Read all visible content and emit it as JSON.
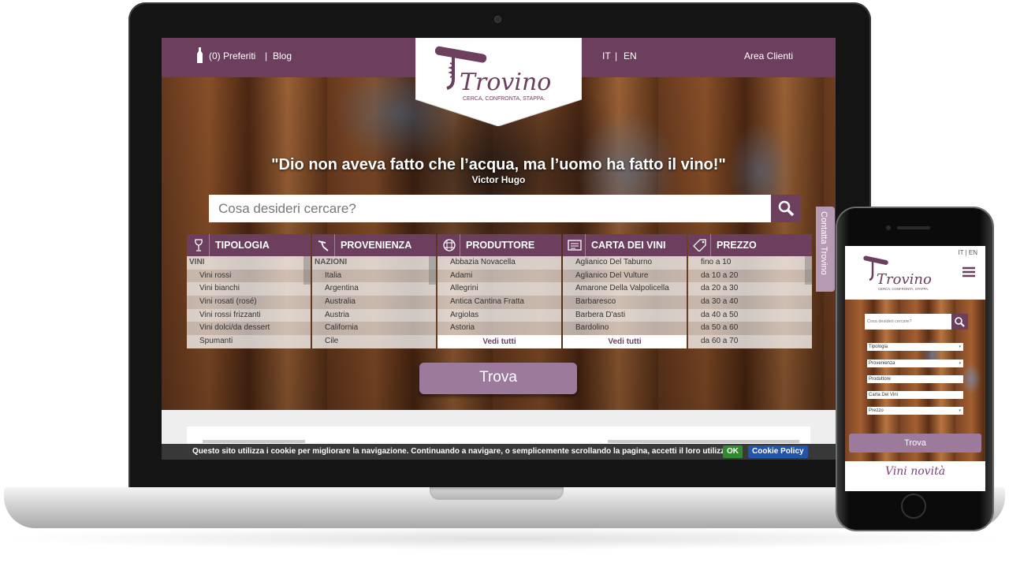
{
  "topbar": {
    "favorites": "(0) Preferiti",
    "separator": "|",
    "blog": "Blog",
    "lang_it": "IT",
    "lang_sep": "|",
    "lang_en": "EN",
    "client_area": "Area Clienti"
  },
  "logo": {
    "name": "Trovino",
    "tagline": "CERCA, CONFRONTA, STAPPA."
  },
  "hero": {
    "quote": "\"Dio non aveva fatto che l’acqua, ma l’uomo ha fatto il vino!\"",
    "author": "Victor Hugo",
    "search_placeholder": "Cosa desideri cercare?",
    "search_icon": "magnifier-icon",
    "submit_label": "Trova"
  },
  "filters": [
    {
      "title": "TIPOLOGIA",
      "icon": "wine-glass-icon",
      "group": "VINI",
      "items": [
        "Vini rossi",
        "Vini bianchi",
        "Vini rosati (rosé)",
        "Vini rossi frizzanti",
        "Vini dolci/da dessert",
        "Spumanti"
      ],
      "more": ""
    },
    {
      "title": "PROVENIENZA",
      "icon": "corkscrew-icon",
      "group": "NAZIONI",
      "items": [
        "Italia",
        "Argentina",
        "Australia",
        "Austria",
        "California",
        "Cile"
      ],
      "more": ""
    },
    {
      "title": "PRODUTTORE",
      "icon": "barrel-icon",
      "group": "",
      "items": [
        "Abbazia Novacella",
        "Adami",
        "Allegrini",
        "Antica Cantina Fratta",
        "Argiolas",
        "Astoria"
      ],
      "more": "Vedi tutti"
    },
    {
      "title": "CARTA DEI VINI",
      "icon": "menu-card-icon",
      "group": "",
      "items": [
        "Aglianico Del Taburno",
        "Aglianico Del Vulture",
        "Amarone Della Valpolicella",
        "Barbaresco",
        "Barbera D'asti",
        "Bardolino"
      ],
      "more": "Vedi tutti"
    },
    {
      "title": "PREZZO",
      "icon": "price-tag-icon",
      "group": "",
      "items": [
        "fino a 10",
        "da 10 a 20",
        "da 20 a 30",
        "da 30 a 40",
        "da 40 a 50",
        "da 50 a 60",
        "da 60 a 70"
      ],
      "more": ""
    }
  ],
  "side_tab": "Contatta Trovino",
  "cookie": {
    "message": "Questo sito utilizza i cookie per migliorare la navigazione. Continuando a navigare, o semplicemente scrollando la pagina, accetti il loro utilizzo.",
    "ok": "OK",
    "policy": "Cookie Policy"
  },
  "mobile": {
    "lang": "IT | EN",
    "search_placeholder": "Cosa desideri cercare?",
    "selects": [
      {
        "label": "Tipologia",
        "has_arrow": true
      },
      {
        "label": "Provenienza",
        "has_arrow": true
      },
      {
        "label": "Produttore",
        "has_arrow": false
      },
      {
        "label": "Carta Dei Vini",
        "has_arrow": false
      },
      {
        "label": "Prezzo",
        "has_arrow": true
      }
    ],
    "submit_label": "Trova",
    "section_title": "Vini novità"
  },
  "colors": {
    "brand": "#6d3f5f",
    "button": "#9b7a9b",
    "ok_green": "#2e8b2e",
    "policy_blue": "#2255aa"
  }
}
